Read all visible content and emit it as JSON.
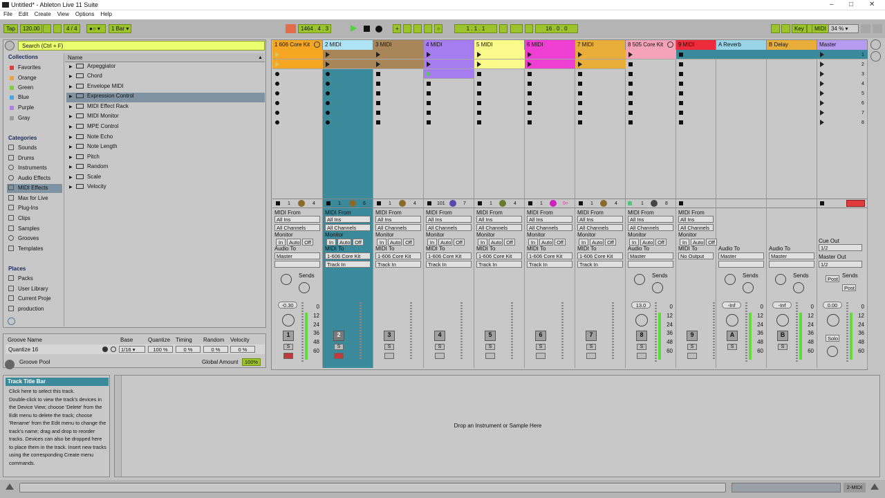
{
  "window": {
    "title": "Untitled* - Ableton Live 11 Suite",
    "controls": [
      "–",
      "□",
      "✕"
    ]
  },
  "menu": [
    "File",
    "Edit",
    "Create",
    "View",
    "Options",
    "Help"
  ],
  "transport": {
    "tap": "Tap",
    "tempo": "120.00",
    "signature": "4 / 4",
    "quantize": "1 Bar",
    "arrangement_pos": "1464 .  4 .  3",
    "loop_start": "1 .  1 .  1",
    "loop_length": "16 .  0 .  0",
    "key": "Key",
    "midi": "MIDI",
    "cpu": "34 %"
  },
  "browser": {
    "search_placeholder": "Search (Ctrl + F)",
    "collections_title": "Collections",
    "collections": [
      {
        "label": "Favorites",
        "color": "#e23b3b"
      },
      {
        "label": "Orange",
        "color": "#f0a13a"
      },
      {
        "label": "Green",
        "color": "#7fcf3a"
      },
      {
        "label": "Blue",
        "color": "#4aa5e8"
      },
      {
        "label": "Purple",
        "color": "#b07ce8"
      },
      {
        "label": "Gray",
        "color": "#9a9a9a"
      }
    ],
    "categories_title": "Categories",
    "categories": [
      "Sounds",
      "Drums",
      "Instruments",
      "Audio Effects",
      "MIDI Effects",
      "Max for Live",
      "Plug-Ins",
      "Clips",
      "Samples",
      "Grooves",
      "Templates"
    ],
    "selected_category": "MIDI Effects",
    "places_title": "Places",
    "places": [
      "Packs",
      "User Library",
      "Current Proje",
      "production"
    ],
    "name_header": "Name",
    "items": [
      "Arpeggiator",
      "Chord",
      "Envelope MIDI",
      "Expression Control",
      "MIDI Effect Rack",
      "MIDI Monitor",
      "MPE Control",
      "Note Echo",
      "Note Length",
      "Pitch",
      "Random",
      "Scale",
      "Velocity"
    ],
    "selected_item": "Expression Control"
  },
  "groove": {
    "headers": [
      "Groove Name",
      "Base",
      "Quantize",
      "Timing",
      "Random",
      "Velocity"
    ],
    "row": {
      "name": "Quantize 16",
      "base": "1/16",
      "quantize": "100 %",
      "timing": "0 %",
      "random": "0 %",
      "velocity": "0 %"
    },
    "pool": "Groove Pool",
    "global_amount_label": "Global Amount",
    "global_amount": "100%"
  },
  "tracks": [
    {
      "name": "1 606 Core Kit",
      "color": "#f5a623",
      "num": "1",
      "vol": "-0.30",
      "audio_to": "Master",
      "midi_to": "",
      "type": "kit"
    },
    {
      "name": "2 MIDI",
      "color": "#aee3f5",
      "num": "2",
      "vol": "",
      "midi_to": "1-606 Core Kit",
      "sub": "Track In",
      "type": "midi"
    },
    {
      "name": "3 MIDI",
      "color": "#a9855a",
      "num": "3",
      "vol": "",
      "midi_to": "1-606 Core Kit",
      "sub": "Track In",
      "type": "midi"
    },
    {
      "name": "4 MIDI",
      "color": "#a57df0",
      "num": "4",
      "vol": "",
      "midi_to": "1-606 Core Kit",
      "sub": "Track In",
      "type": "midi"
    },
    {
      "name": "5 MIDI",
      "color": "#fafa8a",
      "num": "5",
      "vol": "",
      "midi_to": "1-606 Core Kit",
      "sub": "Track In",
      "type": "midi"
    },
    {
      "name": "6 MIDI",
      "color": "#ee3fd2",
      "num": "6",
      "vol": "",
      "midi_to": "1-606 Core Kit",
      "sub": "Track In",
      "type": "midi"
    },
    {
      "name": "7 MIDI",
      "color": "#e9ae3a",
      "num": "7",
      "vol": "",
      "midi_to": "1-606 Core Kit",
      "sub": "Track In",
      "type": "midi"
    },
    {
      "name": "8 505 Core Kit",
      "color": "#f5a3b8",
      "num": "8",
      "vol": "13.0",
      "audio_to": "Master",
      "type": "kit"
    },
    {
      "name": "9 MIDI",
      "color": "#ee2b3b",
      "num": "9",
      "vol": "",
      "midi_to": "No Output",
      "type": "midi"
    },
    {
      "name": "A Reverb",
      "color": "#9ad4e8",
      "num": "A",
      "vol": "-Inf",
      "audio_to": "Master",
      "type": "return"
    },
    {
      "name": "B Delay",
      "color": "#e9ae3a",
      "num": "B",
      "vol": "-Inf",
      "audio_to": "Master",
      "type": "return"
    },
    {
      "name": "Master",
      "color": "#b69cf0",
      "num": "",
      "vol": "0.00",
      "type": "master"
    }
  ],
  "mixer_labels": {
    "midi_from": "MIDI From",
    "all_ins": "All Ins",
    "all_channels": "All Channels",
    "monitor": "Monitor",
    "in": "In",
    "auto": "Auto",
    "off": "Off",
    "audio_to": "Audio To",
    "midi_to": "MIDI To",
    "sends": "Sends",
    "cue_out": "Cue Out",
    "master_out": "Master Out",
    "half": "1/2",
    "post": "Post",
    "solo": "Solo",
    "s": "S",
    "scale": [
      "0",
      "12",
      "24",
      "36",
      "48",
      "60"
    ]
  },
  "scene_numbers": [
    "1",
    "2",
    "3",
    "4",
    "5",
    "6",
    "7",
    "8"
  ],
  "info": {
    "title": "Track Title Bar",
    "body": "Click here to select this track.\nDouble-click to view the track's devices in the Device View; choose 'Delete' from the Edit menu to delete the track; choose 'Rename' from the Edit menu to change the track's name; drag and drop to reorder tracks. Devices can also be dropped here to place them in the track. Insert new tracks using the corresponding Create menu commands."
  },
  "detail": {
    "drop_hint": "Drop an Instrument or Sample Here"
  },
  "status": {
    "selected_track": "2-MIDI"
  }
}
